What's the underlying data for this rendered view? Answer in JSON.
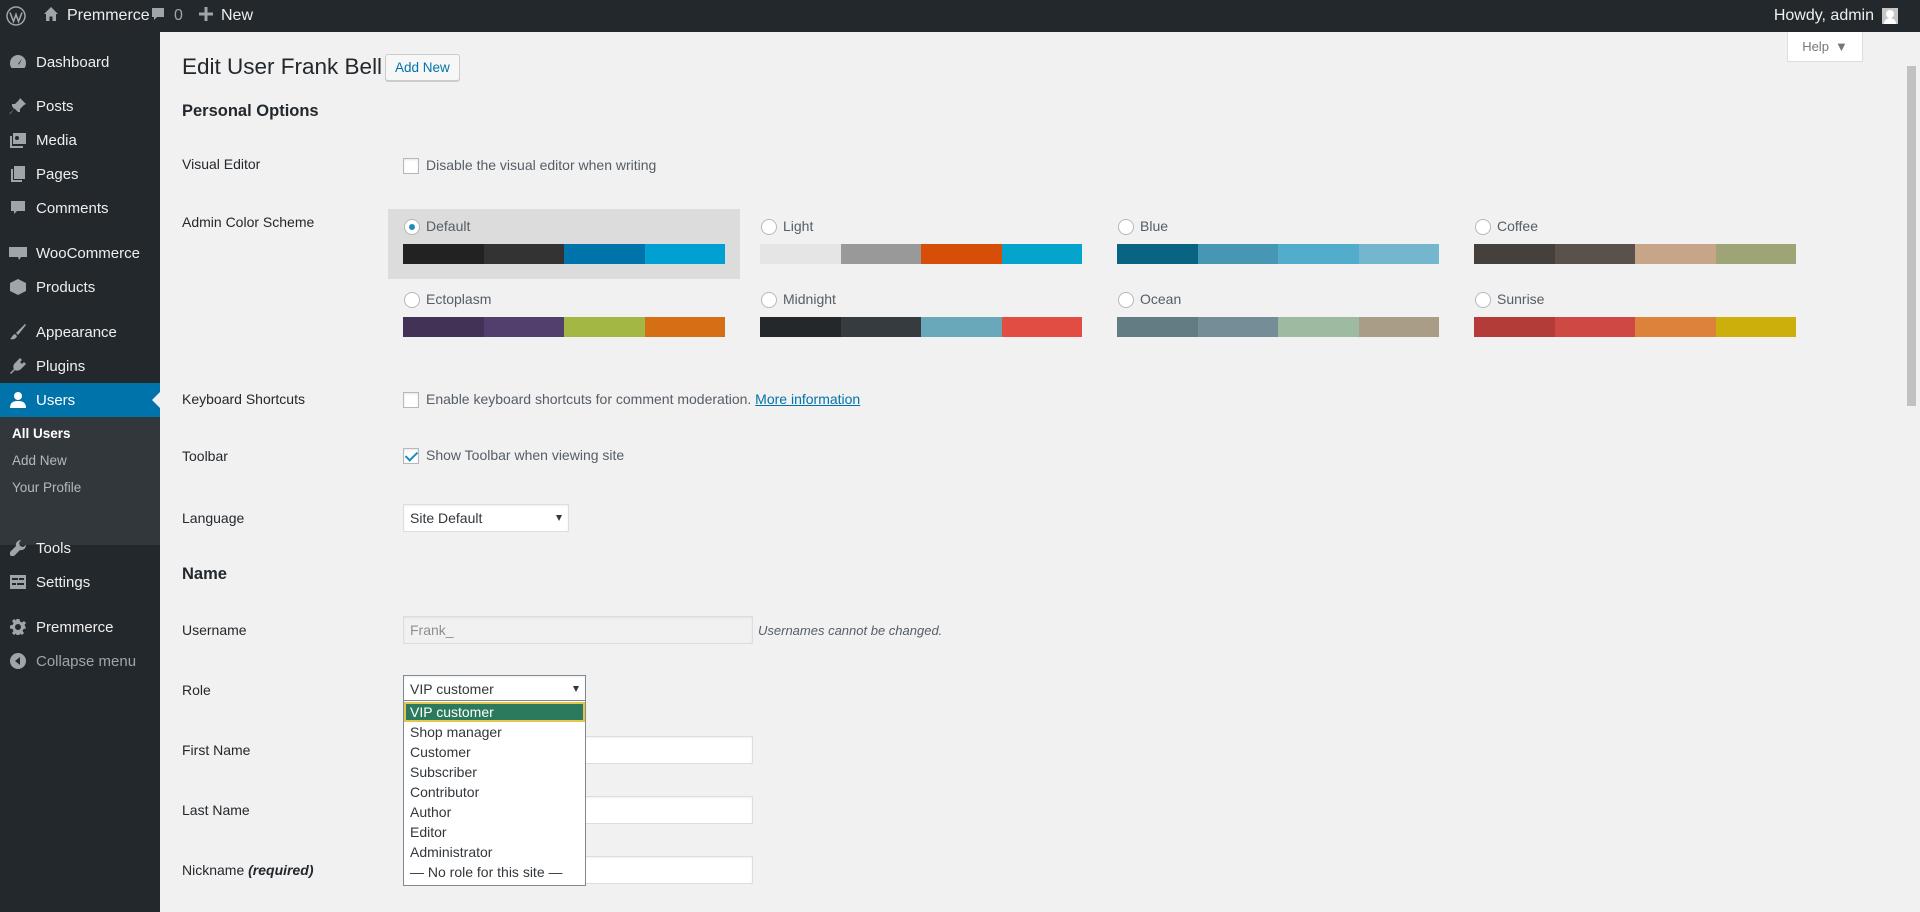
{
  "adminbar": {
    "site_name": "Premmerce",
    "comments_count": "0",
    "new_label": "New",
    "howdy": "Howdy, admin"
  },
  "sidebar": {
    "items": [
      {
        "label": "Dashboard",
        "icon": "dashboard-icon"
      },
      {
        "label": "Posts",
        "icon": "pin-icon"
      },
      {
        "label": "Media",
        "icon": "media-icon"
      },
      {
        "label": "Pages",
        "icon": "pages-icon"
      },
      {
        "label": "Comments",
        "icon": "comment-icon"
      },
      {
        "label": "WooCommerce",
        "icon": "woocommerce-icon"
      },
      {
        "label": "Products",
        "icon": "products-icon"
      },
      {
        "label": "Appearance",
        "icon": "paintbrush-icon"
      },
      {
        "label": "Plugins",
        "icon": "plugin-icon"
      },
      {
        "label": "Users",
        "icon": "user-icon"
      },
      {
        "label": "Tools",
        "icon": "wrench-icon"
      },
      {
        "label": "Settings",
        "icon": "settings-icon"
      },
      {
        "label": "Premmerce",
        "icon": "gear-icon"
      },
      {
        "label": "Collapse menu",
        "icon": "collapse-icon"
      }
    ],
    "submenu": [
      "All Users",
      "Add New",
      "Your Profile"
    ]
  },
  "page": {
    "title": "Edit User Frank Bell",
    "add_new": "Add New",
    "help": "Help"
  },
  "personal_options": {
    "title": "Personal Options",
    "visual_editor_label": "Visual Editor",
    "visual_editor_text": "Disable the visual editor when writing",
    "color_scheme_label": "Admin Color Scheme",
    "schemes": [
      {
        "name": "Default",
        "colors": [
          "#222222",
          "#333333",
          "#0073aa",
          "#00a0d2"
        ],
        "selected": true
      },
      {
        "name": "Light",
        "colors": [
          "#e5e5e5",
          "#999999",
          "#d64e07",
          "#04a4cc"
        ],
        "selected": false
      },
      {
        "name": "Blue",
        "colors": [
          "#096484",
          "#4796b3",
          "#52accc",
          "#74b6ce"
        ],
        "selected": false
      },
      {
        "name": "Coffee",
        "colors": [
          "#46403c",
          "#59524c",
          "#c7a589",
          "#9ea476"
        ],
        "selected": false
      },
      {
        "name": "Ectoplasm",
        "colors": [
          "#413256",
          "#523f6d",
          "#a3b745",
          "#d46f15"
        ],
        "selected": false
      },
      {
        "name": "Midnight",
        "colors": [
          "#25282b",
          "#363b3f",
          "#69a8bb",
          "#e14d43"
        ],
        "selected": false
      },
      {
        "name": "Ocean",
        "colors": [
          "#627c83",
          "#738e96",
          "#9ebaa0",
          "#aa9d88"
        ],
        "selected": false
      },
      {
        "name": "Sunrise",
        "colors": [
          "#b43c38",
          "#cf4944",
          "#dd823b",
          "#ccaf0b"
        ],
        "selected": false
      }
    ],
    "keyboard_label": "Keyboard Shortcuts",
    "keyboard_text": "Enable keyboard shortcuts for comment moderation.",
    "keyboard_link": "More information",
    "toolbar_label": "Toolbar",
    "toolbar_text": "Show Toolbar when viewing site",
    "language_label": "Language",
    "language_value": "Site Default"
  },
  "name_section": {
    "title": "Name",
    "username_label": "Username",
    "username_value": "Frank_",
    "username_note": "Usernames cannot be changed.",
    "role_label": "Role",
    "role_value": "VIP customer",
    "role_options": [
      "VIP customer",
      "Shop manager",
      "Customer",
      "Subscriber",
      "Contributor",
      "Author",
      "Editor",
      "Administrator",
      "— No role for this site —"
    ],
    "first_name_label": "First Name",
    "last_name_label": "Last Name",
    "nickname_label": "Nickname",
    "nickname_required": "(required)"
  }
}
